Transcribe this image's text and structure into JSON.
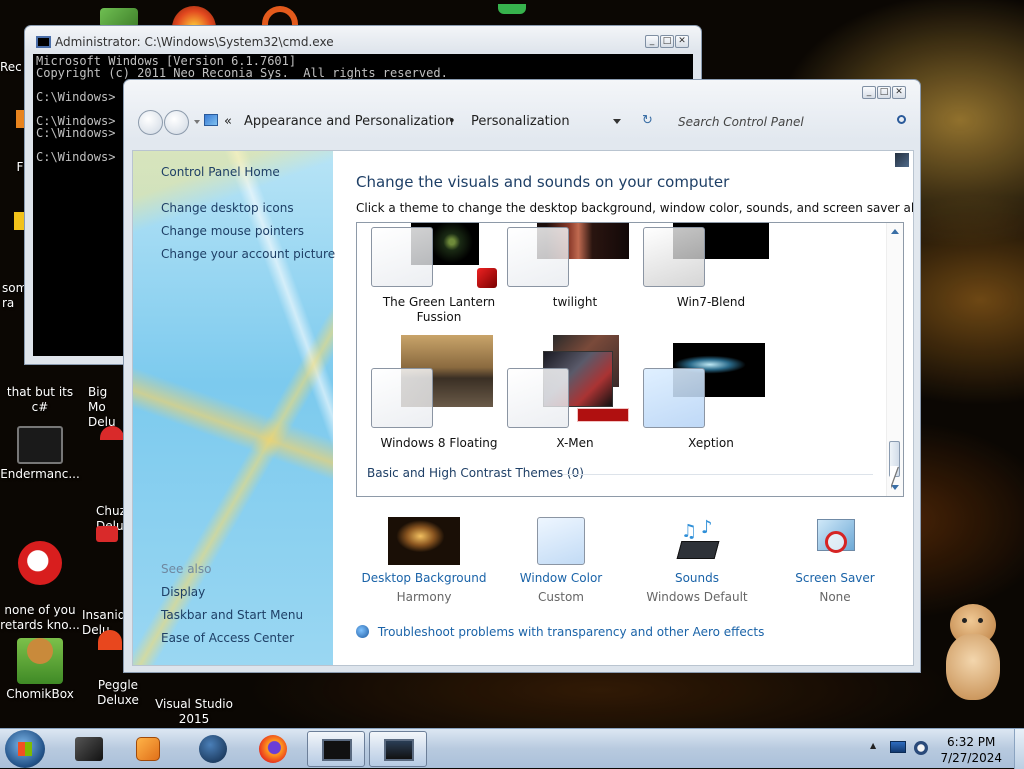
{
  "desktop": {
    "icons": [
      {
        "label": "that but its c#"
      },
      {
        "label": "Big Mo\nDelu"
      },
      {
        "label": "Endermanc..."
      },
      {
        "label": "Chuz\nDelu"
      },
      {
        "label": "none of you\nretards kno..."
      },
      {
        "label": "Insaniq\nDelu"
      },
      {
        "label": "ChomikBox"
      },
      {
        "label": "Peggle Deluxe"
      },
      {
        "label": "Visual Studio\n2015"
      }
    ],
    "partial_labels": [
      "Rec",
      "F",
      "som\nra"
    ]
  },
  "cmd_window": {
    "title": "Administrator: C:\\Windows\\System32\\cmd.exe",
    "lines": [
      "Microsoft Windows [Version 6.1.7601]",
      "Copyright (c) 2011 Neo Reconia Sys.  All rights reserved.",
      "",
      "C:\\Windows>",
      "",
      "C:\\Windows>",
      "C:\\Windows>",
      "",
      "C:\\Windows>"
    ]
  },
  "control_panel": {
    "breadcrumb": {
      "chevrons": "«",
      "parent": "Appearance and Personalization",
      "separator": "•",
      "current": "Personalization"
    },
    "search": {
      "placeholder": "Search Control Panel"
    },
    "sidebar": {
      "home": "Control Panel Home",
      "links": [
        "Change desktop icons",
        "Change mouse pointers",
        "Change your account picture"
      ],
      "see_also_title": "See also",
      "see_also": [
        "Display",
        "Taskbar and Start Menu",
        "Ease of Access Center"
      ]
    },
    "heading": "Change the visuals and sounds on your computer",
    "subheading": "Click a theme to change the desktop background, window color, sounds, and screen saver all at once.",
    "themes": [
      {
        "name": "The Green Lantern\nFussion"
      },
      {
        "name": "twilight"
      },
      {
        "name": "Win7-Blend"
      },
      {
        "name": "Windows 8 Floating"
      },
      {
        "name": "X-Men"
      },
      {
        "name": "Xeption"
      }
    ],
    "basic_themes_link": "Basic and High Contrast Themes (0)",
    "bottom_items": [
      {
        "label": "Desktop Background",
        "value": "Harmony"
      },
      {
        "label": "Window Color",
        "value": "Custom"
      },
      {
        "label": "Sounds",
        "value": "Windows Default"
      },
      {
        "label": "Screen Saver",
        "value": "None"
      }
    ],
    "troubleshoot_link": "Troubleshoot problems with transparency and other Aero effects",
    "caption_buttons": {
      "minimize": "_",
      "maximize": "□",
      "close": "✕"
    }
  },
  "taskbar": {
    "time": "6:32 PM",
    "date": "7/27/2024",
    "tray_arrow": "▲"
  },
  "colors": {
    "link_blue": "#1a63a8",
    "heading_blue": "#1e3f66",
    "sidebar_blue": "#7ccaee",
    "taskbar": "#b8cadf"
  }
}
